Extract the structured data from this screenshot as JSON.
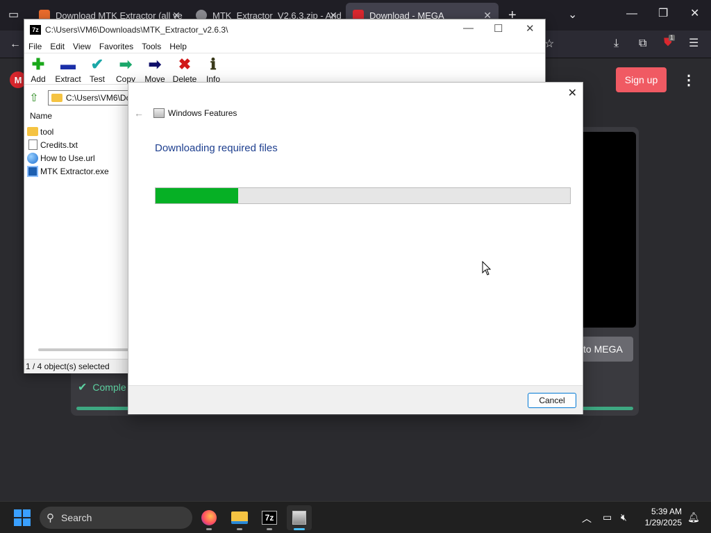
{
  "browser": {
    "tabs": [
      {
        "label": "Download MTK Extractor (all ve",
        "favicon_color": "#e86a2b",
        "active": false
      },
      {
        "label": "MTK_Extractor_V2.6.3.zip - And",
        "favicon_color": "#8a8a90",
        "active": false
      },
      {
        "label": "Download - MEGA",
        "favicon_color": "#d9272e",
        "active": true
      }
    ],
    "new_tab_symbol": "+",
    "extensions_badge": "1",
    "mega": {
      "logo": "M",
      "signup_label": "Sign up",
      "to_mega_label": "to MEGA",
      "complete_label": "Comple"
    }
  },
  "sevenzip": {
    "title_path": "C:\\Users\\VM6\\Downloads\\MTK_Extractor_v2.6.3\\",
    "app_icon_text": "7z",
    "menu": [
      "File",
      "Edit",
      "View",
      "Favorites",
      "Tools",
      "Help"
    ],
    "toolbar": [
      {
        "label": "Add",
        "icon": "plus-icon",
        "glyph": "✚",
        "color": "#1aa81a"
      },
      {
        "label": "Extract",
        "icon": "minus-icon",
        "glyph": "▬",
        "color": "#1b2fa8"
      },
      {
        "label": "Test",
        "icon": "check-icon",
        "glyph": "✔",
        "color": "#1aa7a7"
      },
      {
        "label": "Copy",
        "icon": "copy-arrow-icon",
        "glyph": "➡",
        "color": "#1aa76a"
      },
      {
        "label": "Move",
        "icon": "move-arrow-icon",
        "glyph": "➡",
        "color": "#10106a"
      },
      {
        "label": "Delete",
        "icon": "delete-icon",
        "glyph": "✖",
        "color": "#d11a1a"
      },
      {
        "label": "Info",
        "icon": "info-icon",
        "glyph": "ℹ",
        "color": "#3a3a1a"
      }
    ],
    "address": "C:\\Users\\VM6\\Do",
    "column_header": "Name",
    "files": [
      {
        "name": "tool",
        "type": "folder"
      },
      {
        "name": "Credits.txt",
        "type": "txt"
      },
      {
        "name": "How to Use.url",
        "type": "url"
      },
      {
        "name": "MTK Extractor.exe",
        "type": "exe"
      }
    ],
    "status": "1 / 4 object(s) selected"
  },
  "windows_features": {
    "title": "Windows Features",
    "heading": "Downloading required files",
    "progress_fraction": 0.2,
    "progress_color": "#06b025",
    "cancel_label": "Cancel"
  },
  "taskbar": {
    "search_label": "Search",
    "time": "5:39 AM",
    "date": "1/29/2025"
  }
}
